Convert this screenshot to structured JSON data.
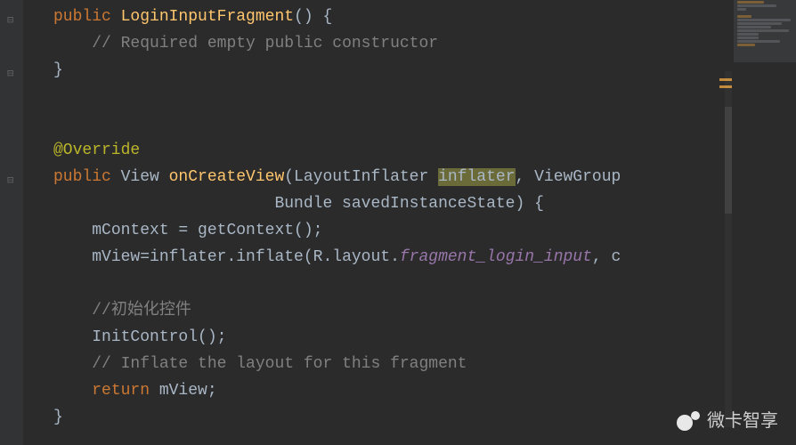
{
  "code": {
    "l1_kw": "public",
    "l1_method": "LoginInputFragment",
    "l1_rest": "() {",
    "l2_comment": "// Required empty public constructor",
    "l3": "}",
    "l5_annotation": "@Override",
    "l6_kw": "public",
    "l6_type": " View ",
    "l6_method": "onCreateView",
    "l6_paren": "(LayoutInflater ",
    "l6_hl": "inflater",
    "l6_after": ", ViewGroup",
    "l7": "                       Bundle savedInstanceState) {",
    "l8_pre": "mContext = getContext();",
    "l9_pre": "mView=inflater.inflate(R.layout.",
    "l9_field": "fragment_login_input",
    "l9_post": ", c",
    "l11_comment": "//初始化控件",
    "l12": "InitControl();",
    "l13_comment": "// Inflate the layout for this fragment",
    "l14_kw": "return",
    "l14_rest": " mView;",
    "l15": "}"
  },
  "watermark": {
    "text": "微卡智享"
  }
}
